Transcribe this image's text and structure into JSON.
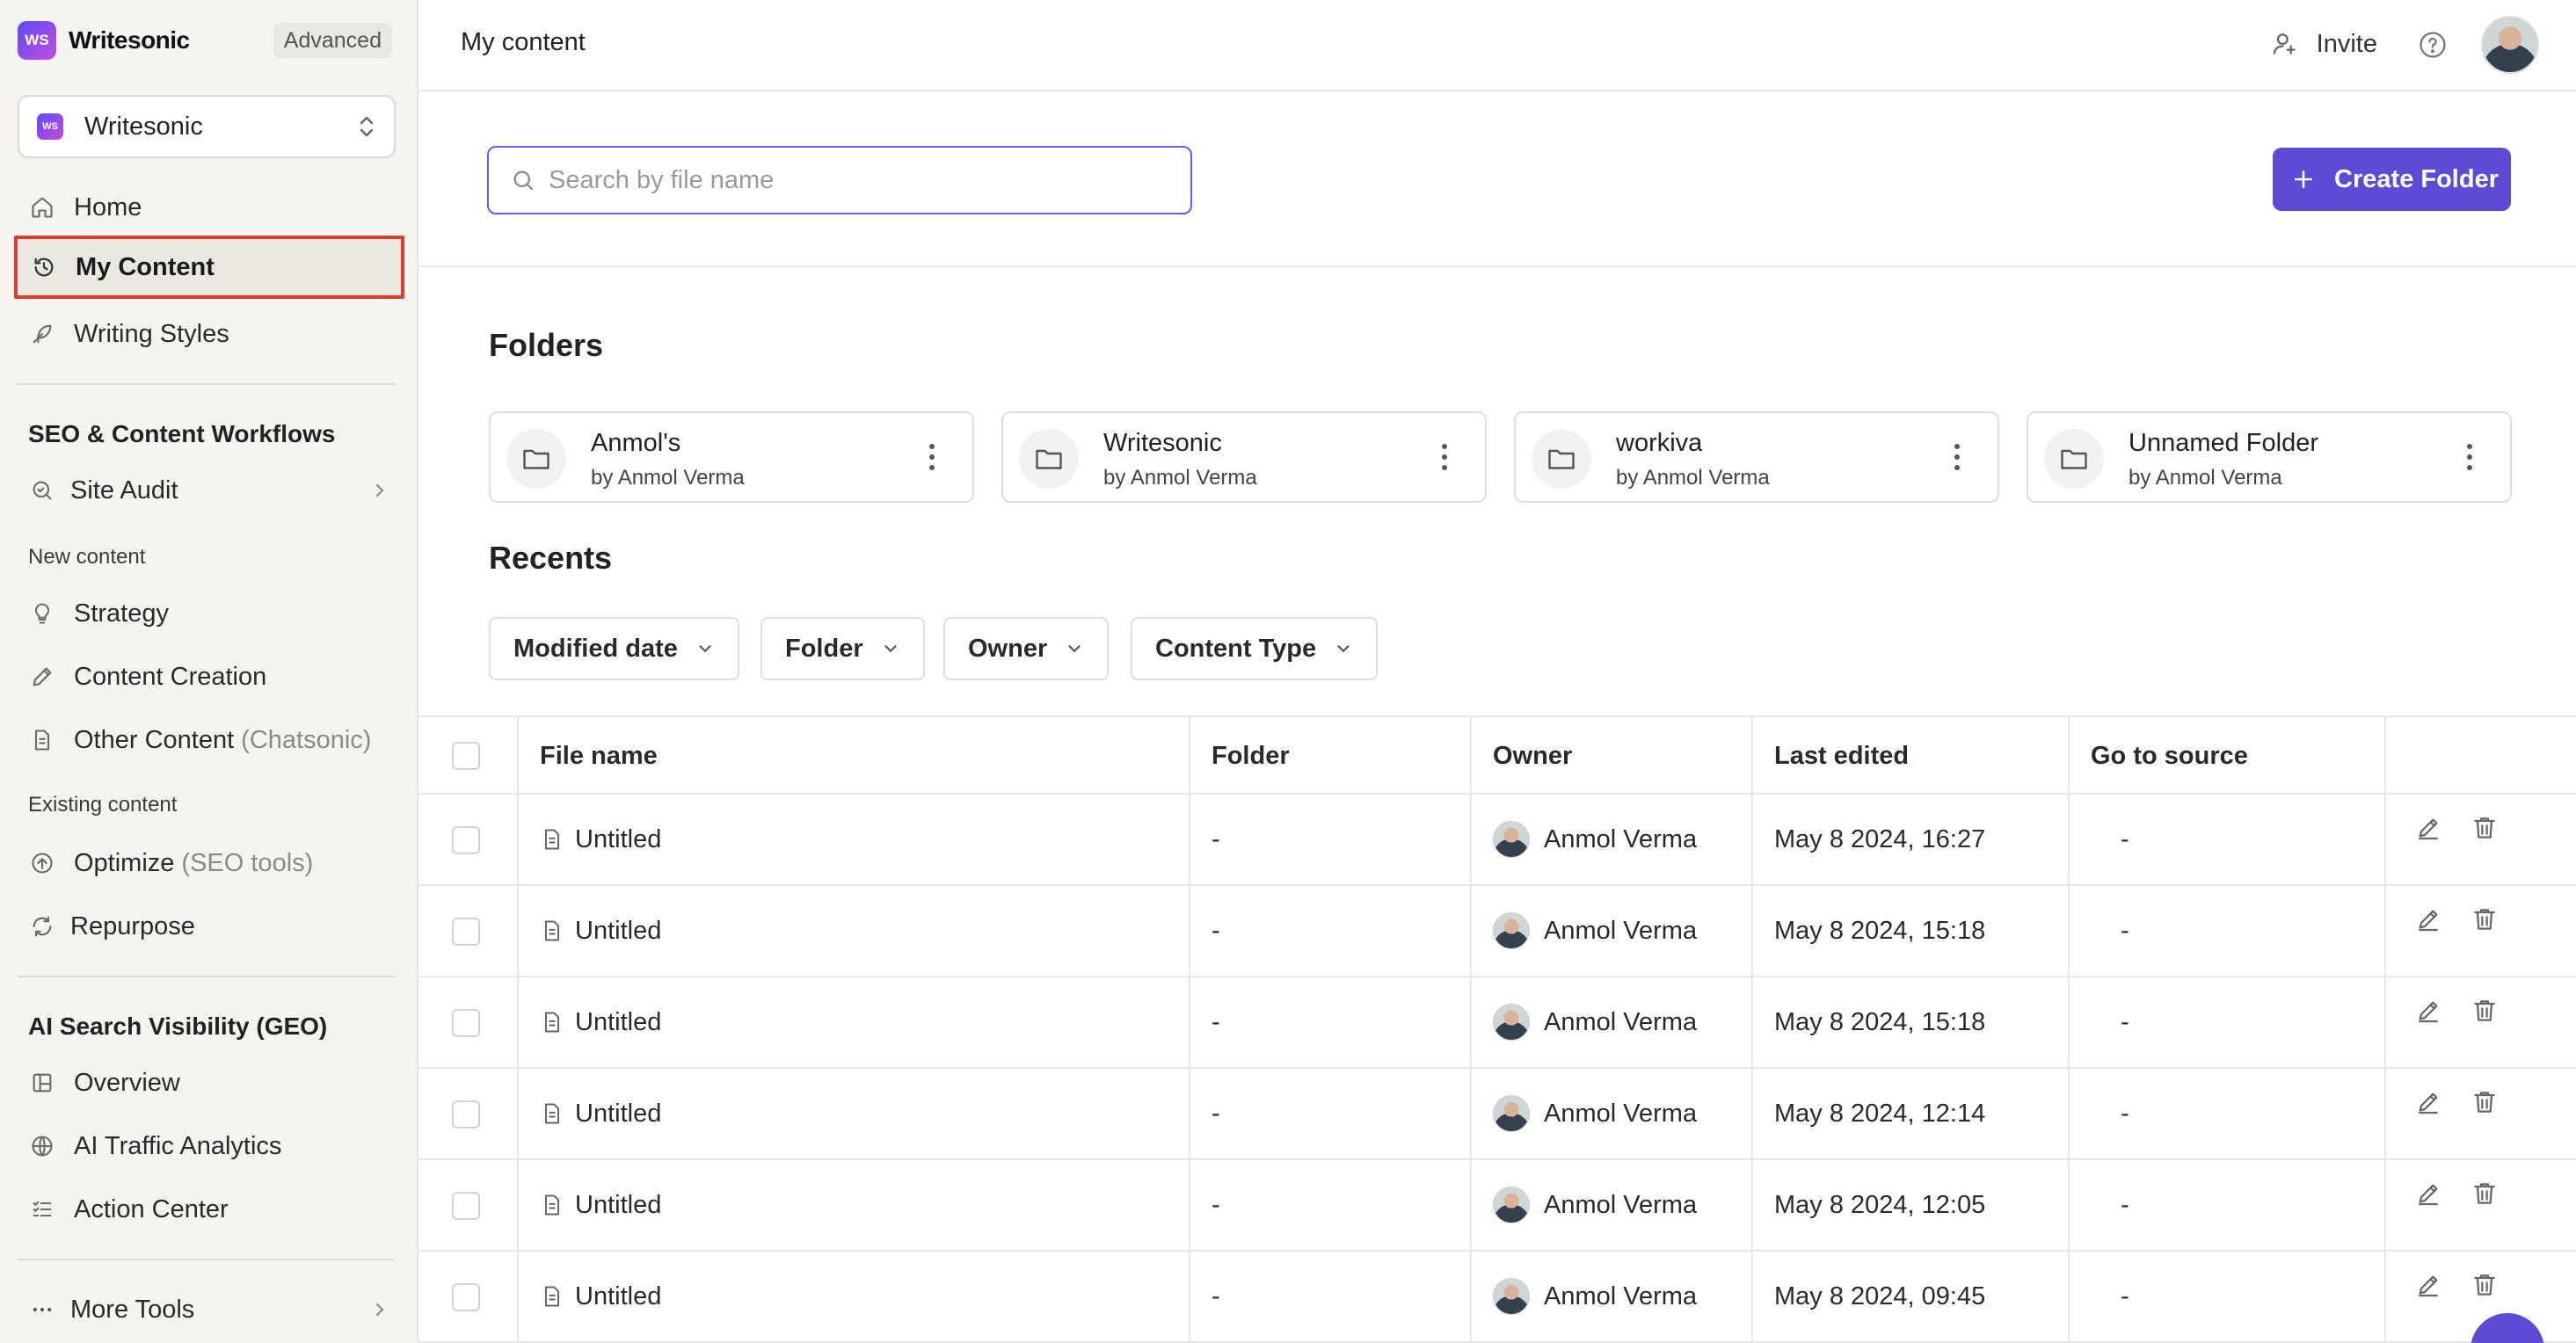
{
  "brand": {
    "name": "Writesonic",
    "logo_text": "WS",
    "plan": "Advanced"
  },
  "workspace": {
    "name": "Writesonic",
    "logo_text": "WS"
  },
  "sidebar": {
    "top_items": [
      {
        "label": "Home",
        "icon": "home-icon"
      },
      {
        "label": "My Content",
        "icon": "history-icon",
        "active": true
      },
      {
        "label": "Writing Styles",
        "icon": "feather-icon"
      }
    ],
    "seo_section": {
      "title": "SEO & Content Workflows",
      "site_audit": "Site Audit"
    },
    "new_content": {
      "title": "New content",
      "items": [
        "Strategy",
        "Content Creation",
        "Other Content"
      ],
      "other_suffix": "(Chatsonic)"
    },
    "existing_content": {
      "title": "Existing content",
      "optimize": "Optimize",
      "optimize_suffix": "(SEO tools)",
      "repurpose": "Repurpose"
    },
    "geo_section": {
      "title": "AI Search Visibility (GEO)",
      "items": [
        "Overview",
        "AI Traffic Analytics",
        "Action Center"
      ]
    },
    "more_tools": "More Tools"
  },
  "topbar": {
    "title": "My content",
    "invite": "Invite"
  },
  "search": {
    "placeholder": "Search by file name",
    "value": ""
  },
  "create_folder": "Create Folder",
  "folders_heading": "Folders",
  "folders": [
    {
      "name": "Anmol's",
      "owner": "by Anmol Verma"
    },
    {
      "name": "Writesonic",
      "owner": "by Anmol Verma"
    },
    {
      "name": "workiva",
      "owner": "by Anmol Verma"
    },
    {
      "name": "Unnamed Folder",
      "owner": "by Anmol Verma"
    }
  ],
  "recents_heading": "Recents",
  "filters": [
    "Modified date",
    "Folder",
    "Owner",
    "Content Type"
  ],
  "table": {
    "headers": [
      "File name",
      "Folder",
      "Owner",
      "Last edited",
      "Go to source"
    ],
    "rows": [
      {
        "file": "Untitled",
        "folder": "-",
        "owner": "Anmol Verma",
        "edited": "May 8 2024, 16:27",
        "source": "-"
      },
      {
        "file": "Untitled",
        "folder": "-",
        "owner": "Anmol Verma",
        "edited": "May 8 2024, 15:18",
        "source": "-"
      },
      {
        "file": "Untitled",
        "folder": "-",
        "owner": "Anmol Verma",
        "edited": "May 8 2024, 15:18",
        "source": "-"
      },
      {
        "file": "Untitled",
        "folder": "-",
        "owner": "Anmol Verma",
        "edited": "May 8 2024, 12:14",
        "source": "-"
      },
      {
        "file": "Untitled",
        "folder": "-",
        "owner": "Anmol Verma",
        "edited": "May 8 2024, 12:05",
        "source": "-"
      },
      {
        "file": "Untitled",
        "folder": "-",
        "owner": "Anmol Verma",
        "edited": "May 8 2024, 09:45",
        "source": "-"
      }
    ]
  },
  "colors": {
    "accent": "#5b4bd5",
    "active_outline": "#e03c2e",
    "sidebar_bg": "#f6f4ef"
  }
}
